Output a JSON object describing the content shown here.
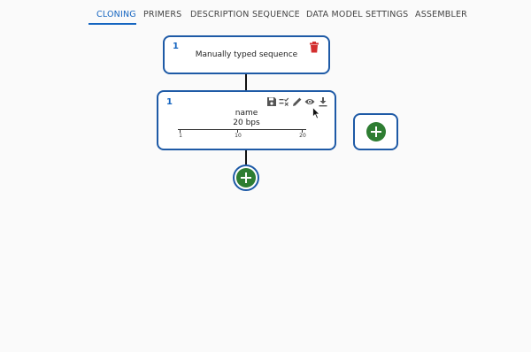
{
  "tabs": [
    {
      "label": "CLONING",
      "active": true
    },
    {
      "label": "PRIMERS",
      "active": false
    },
    {
      "label": "DESCRIPTION",
      "active": false
    },
    {
      "label": "SEQUENCE",
      "active": false
    },
    {
      "label": "DATA MODEL",
      "active": false
    },
    {
      "label": "SETTINGS",
      "active": false
    },
    {
      "label": "ASSEMBLER",
      "active": false
    }
  ],
  "source_card": {
    "index": "1",
    "text": "Manually typed sequence",
    "delete_icon": "trash-icon"
  },
  "sequence_card": {
    "index": "1",
    "name": "name",
    "length": "20 bps",
    "actions": [
      "save-icon",
      "checklist-icon",
      "pencil-icon",
      "eye-icon",
      "download-icon"
    ],
    "ruler_ticks": [
      "1",
      "10",
      "20"
    ]
  },
  "add_buttons": {
    "below": "add-icon",
    "side": "add-icon"
  },
  "colors": {
    "accent": "#1565c0",
    "border": "#1e5aa6",
    "add_green": "#2e7d32",
    "delete_red": "#d32f2f"
  }
}
